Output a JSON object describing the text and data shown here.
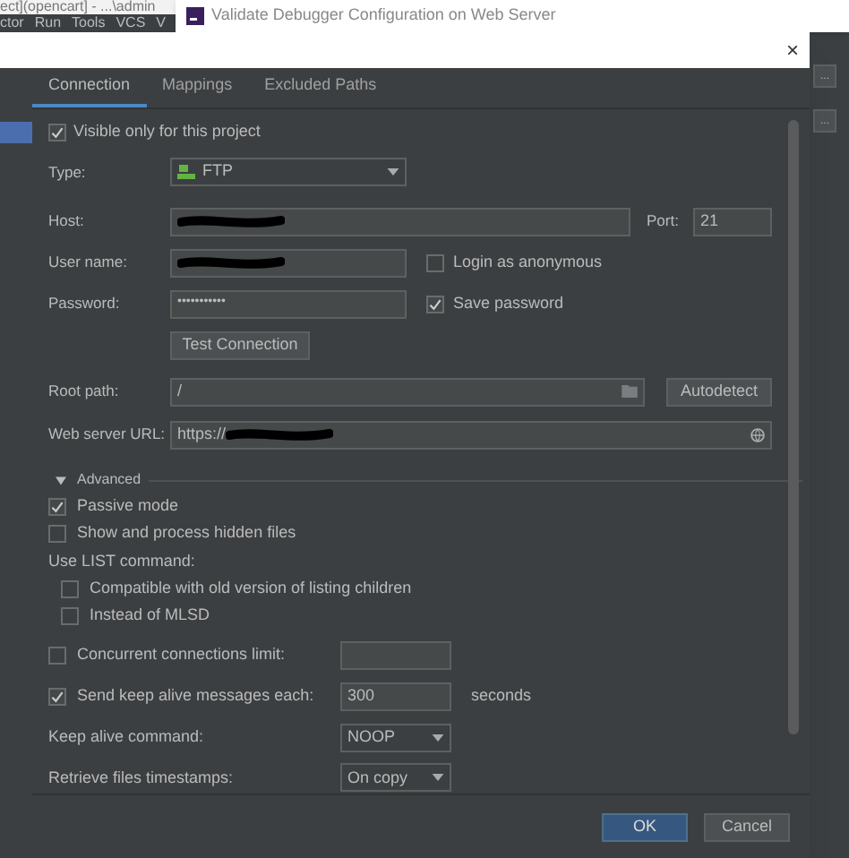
{
  "background_window": {
    "title": "ect](opencart] - ...\\admin",
    "menu": [
      "ctor",
      "Run",
      "Tools",
      "VCS",
      "V"
    ],
    "side_buttons": [
      "...",
      "..."
    ]
  },
  "validate_window": {
    "title": "Validate Debugger Configuration on Web Server"
  },
  "dialog": {
    "close": "×",
    "tabs": [
      {
        "label": "Connection",
        "selected": true
      },
      {
        "label": "Mappings",
        "selected": false
      },
      {
        "label": "Excluded Paths",
        "selected": false
      }
    ],
    "visible_only": {
      "label": "Visible only for this project",
      "checked": true
    },
    "type": {
      "label": "Type:",
      "value": "FTP"
    },
    "host": {
      "label": "Host:",
      "redacted": true
    },
    "port": {
      "label": "Port:",
      "value": "21"
    },
    "user_name": {
      "label": "User name:",
      "redacted": true
    },
    "login_anonymous": {
      "label": "Login as anonymous",
      "checked": false
    },
    "password": {
      "label": "Password:",
      "value": "•••••••••••"
    },
    "save_password": {
      "label": "Save password",
      "checked": true
    },
    "test_connection": "Test Connection",
    "root_path": {
      "label": "Root path:",
      "value": "/"
    },
    "autodetect": "Autodetect",
    "web_server_url": {
      "label": "Web server URL:",
      "value": "https://",
      "redacted": true
    },
    "advanced": {
      "label": "Advanced",
      "expanded": true,
      "options": [
        {
          "kind": "checkbox",
          "label": "Passive mode",
          "checked": true
        },
        {
          "kind": "checkbox",
          "label": "Show and process hidden files",
          "checked": false
        },
        {
          "kind": "heading",
          "label": "Use  LIST command:"
        },
        {
          "kind": "subcheckbox",
          "label": "Compatible with old version of listing children",
          "checked": false
        },
        {
          "kind": "subcheckbox",
          "label": "Instead of MLSD",
          "checked": false
        },
        {
          "kind": "checkfield",
          "label": "Concurrent connections limit:",
          "checked": false
        },
        {
          "kind": "checkfield",
          "label": "Send keep alive messages each:",
          "checked": true,
          "value": "300",
          "suffix": "seconds"
        },
        {
          "kind": "dropdown",
          "label": "Keep alive command:",
          "value": "NOOP"
        },
        {
          "kind": "dropdown",
          "label": "Retrieve files timestamps:",
          "value": "On copy"
        }
      ]
    },
    "buttons": [
      {
        "label": "OK",
        "kind": "primary"
      },
      {
        "label": "Cancel",
        "kind": "secondary"
      }
    ]
  }
}
